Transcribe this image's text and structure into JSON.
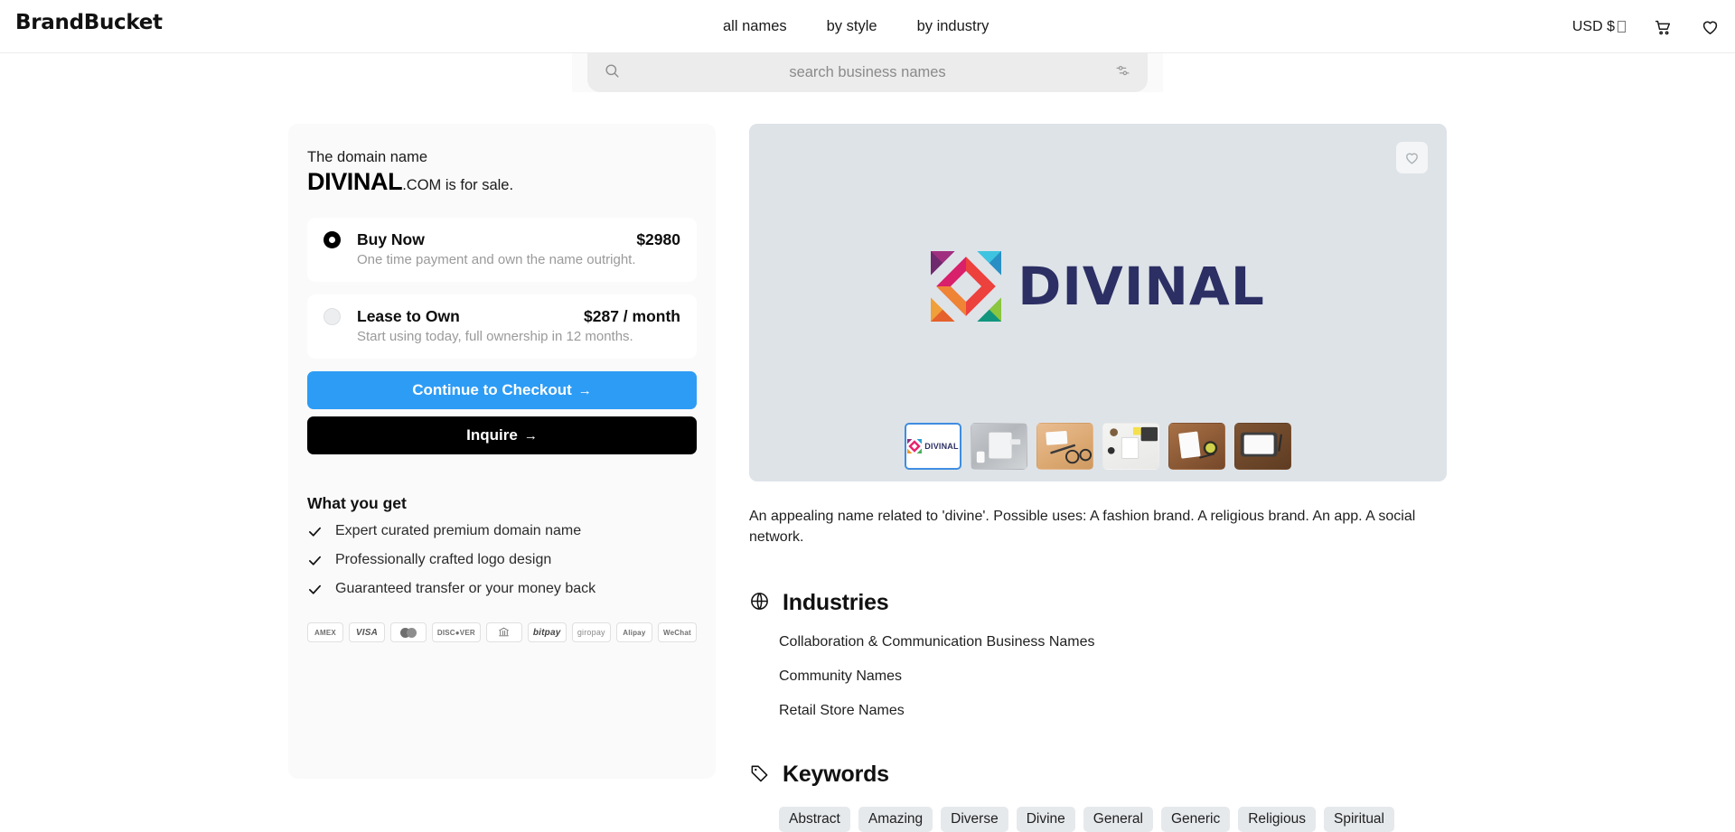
{
  "header": {
    "brand": "BrandBucket",
    "nav": [
      {
        "label": "all names"
      },
      {
        "label": "by style"
      },
      {
        "label": "by industry"
      }
    ],
    "currency": "USD $",
    "cart_icon": "cart-icon",
    "wishlist_icon": "heart-icon"
  },
  "search": {
    "placeholder": "search business names",
    "value": "",
    "search_icon": "search-icon",
    "filter_icon": "sliders-icon"
  },
  "offer": {
    "eyebrow": "The domain name",
    "domain_name": "DIVINAL",
    "domain_suffix": ".COM is for sale.",
    "options": [
      {
        "title": "Buy Now",
        "price": "$2980",
        "subtitle": "One time payment and own the name outright.",
        "selected": true
      },
      {
        "title": "Lease to Own",
        "price": "$287 / month",
        "subtitle": "Start using today, full ownership in 12 months.",
        "selected": false
      }
    ],
    "checkout_label": "Continue to Checkout",
    "checkout_arrow": "→",
    "inquire_label": "Inquire",
    "inquire_arrow": "→",
    "accent_color": "#2d9cf5",
    "inquire_color": "#000000"
  },
  "what_you_get": {
    "title": "What you get",
    "items": [
      "Expert curated premium domain name",
      "Professionally crafted logo design",
      "Guaranteed transfer or your money back"
    ]
  },
  "payments": [
    {
      "label": "AMEX",
      "kind": "text"
    },
    {
      "label": "VISA",
      "kind": "visa"
    },
    {
      "label": "",
      "kind": "mastercard"
    },
    {
      "label": "DISC●VER",
      "kind": "text"
    },
    {
      "label": "",
      "kind": "bank"
    },
    {
      "label": "bitpay",
      "kind": "bitpay"
    },
    {
      "label": "giropay",
      "kind": "giropay"
    },
    {
      "label": "Alipay",
      "kind": "text"
    },
    {
      "label": "WeChat",
      "kind": "text"
    }
  ],
  "preview": {
    "favorite_icon": "heart-icon",
    "logo_text": "DIVINAL",
    "logo_text_color": "#2c2f63",
    "background_color": "#dee3e8",
    "thumbnails": [
      {
        "name": "logo-thumbnail",
        "active": true,
        "bg": "#ffffff"
      },
      {
        "name": "mockup-stationery-gray",
        "active": false,
        "bg": "#b9bcc0"
      },
      {
        "name": "mockup-card-glasses",
        "active": false,
        "bg": "#e3b182"
      },
      {
        "name": "mockup-desk-notebook",
        "active": false,
        "bg": "#f0f0ee"
      },
      {
        "name": "mockup-wood-journal",
        "active": false,
        "bg": "#9c6a46"
      },
      {
        "name": "mockup-tablet-wood",
        "active": false,
        "bg": "#6f4426"
      }
    ],
    "description": "An appealing name related to 'divine'. Possible uses: A fashion brand. A religious brand. An app. A social network."
  },
  "industries": {
    "icon": "globe-icon",
    "title": "Industries",
    "items": [
      "Collaboration & Communication Business Names",
      "Community Names",
      "Retail Store Names"
    ]
  },
  "keywords": {
    "icon": "tag-icon",
    "title": "Keywords",
    "items": [
      "Abstract",
      "Amazing",
      "Diverse",
      "Divine",
      "General",
      "Generic",
      "Religious",
      "Spiritual"
    ]
  }
}
